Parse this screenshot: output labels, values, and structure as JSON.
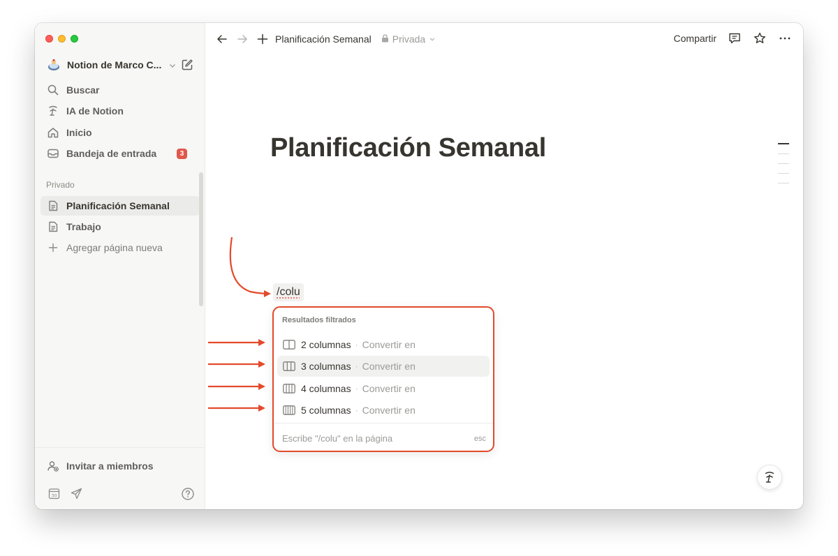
{
  "sidebar": {
    "workspace_name": "Notion de Marco C...",
    "nav": [
      {
        "label": "Buscar"
      },
      {
        "label": "IA de Notion"
      },
      {
        "label": "Inicio"
      },
      {
        "label": "Bandeja de entrada",
        "badge": "3"
      }
    ],
    "section_label": "Privado",
    "pages": [
      {
        "label": "Planificación Semanal"
      },
      {
        "label": "Trabajo"
      },
      {
        "label": "Agregar página nueva"
      }
    ],
    "invite_label": "Invitar a miembros"
  },
  "topbar": {
    "breadcrumb_title": "Planificación Semanal",
    "privacy_label": "Privada",
    "share_label": "Compartir"
  },
  "page": {
    "title": "Planificación Semanal",
    "slash_text": "/colu"
  },
  "menu": {
    "heading": "Resultados filtrados",
    "items": [
      {
        "label": "2 columnas",
        "hint": "Convertir en"
      },
      {
        "label": "3 columnas",
        "hint": "Convertir en"
      },
      {
        "label": "4 columnas",
        "hint": "Convertir en"
      },
      {
        "label": "5 columnas",
        "hint": "Convertir en"
      }
    ],
    "footer": "Escribe \"/colu\" en la página",
    "esc": "esc"
  },
  "colors": {
    "annotation_red": "#e34a2b",
    "badge_red": "#e1574c",
    "sidebar_bg": "#f7f7f5"
  }
}
